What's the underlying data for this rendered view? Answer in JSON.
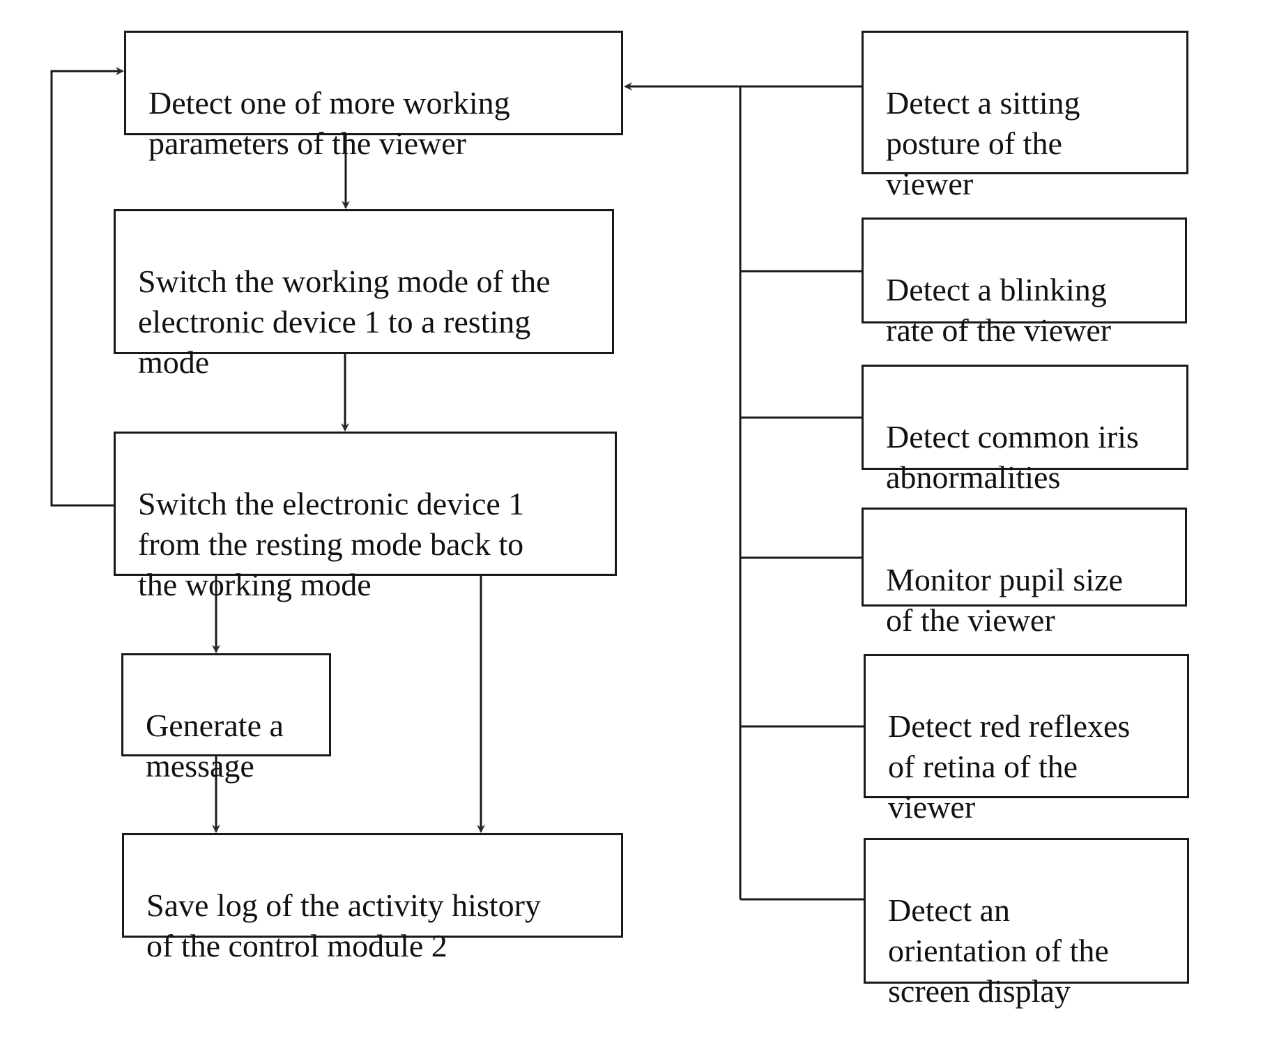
{
  "diagram": {
    "type": "flowchart",
    "main_flow": [
      {
        "id": "detect_params",
        "text": "Detect one of more working\nparameters of the viewer"
      },
      {
        "id": "switch_rest",
        "text": "Switch the working mode of the\nelectronic device 1 to a resting\nmode"
      },
      {
        "id": "switch_back",
        "text": "Switch the electronic device 1\nfrom the resting mode back to\nthe working mode"
      },
      {
        "id": "generate_message",
        "text": "Generate a\nmessage"
      },
      {
        "id": "save_log",
        "text": "Save log of the activity history\nof the control module 2"
      }
    ],
    "parameters": [
      {
        "id": "sitting_posture",
        "text": "Detect a sitting\nposture of the\nviewer"
      },
      {
        "id": "blinking_rate",
        "text": "Detect a blinking\nrate of the viewer"
      },
      {
        "id": "iris",
        "text": "Detect common iris\nabnormalities"
      },
      {
        "id": "pupil",
        "text": "Monitor pupil size\nof the viewer"
      },
      {
        "id": "red_reflex",
        "text": "Detect red reflexes\nof retina of the\nviewer"
      },
      {
        "id": "orientation",
        "text": "Detect an\norientation of the\nscreen display"
      }
    ],
    "edges": [
      {
        "from": "detect_params",
        "to": "switch_rest"
      },
      {
        "from": "switch_rest",
        "to": "switch_back"
      },
      {
        "from": "switch_back",
        "to": "detect_params"
      },
      {
        "from": "switch_back",
        "to": "generate_message"
      },
      {
        "from": "switch_back",
        "to": "save_log"
      },
      {
        "from": "generate_message",
        "to": "save_log"
      },
      {
        "from": "parameters",
        "to": "detect_params"
      }
    ],
    "colors": {
      "line": "#1a1a1a",
      "background": "#ffffff"
    }
  }
}
